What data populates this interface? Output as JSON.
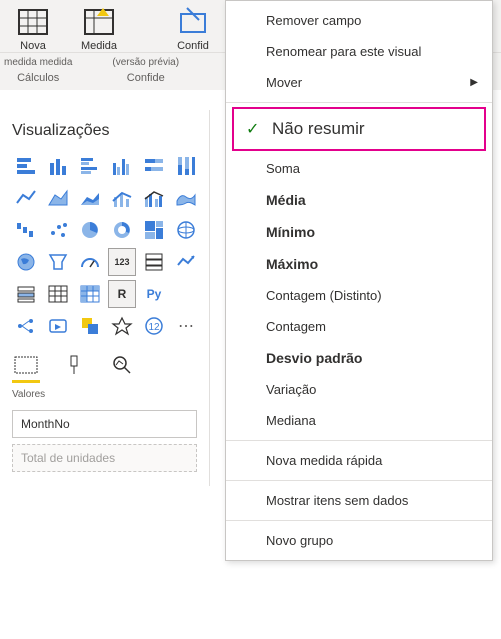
{
  "ribbon": {
    "nova": "Nova",
    "medida": "Medida",
    "confid": "Confid",
    "medida_medida": "medida medida",
    "versao_previa": "(versão prévia)",
    "calculos": "Cálculos",
    "confide": "Confide"
  },
  "panel": {
    "header": "Visualizações",
    "r_label": "R",
    "py_label": "Py",
    "tab_values": "Valores"
  },
  "fields": {
    "monthno": "MonthNo",
    "placeholder": "Total de unidades"
  },
  "menu": {
    "remover": "Remover campo",
    "renomear": "Renomear para este visual",
    "mover": "Mover",
    "nao_resumir": "Não resumir",
    "soma": "Soma",
    "media": "Média",
    "minimo": "Mínimo",
    "maximo": "Máximo",
    "contagem_distinto": "Contagem (Distinto)",
    "contagem": "Contagem",
    "desvio": "Desvio padrão",
    "variacao": "Variação",
    "mediana": "Mediana",
    "nova_medida": "Nova medida rápida",
    "mostrar_sem_dados": "Mostrar itens sem dados",
    "novo_grupo": "Novo grupo"
  }
}
